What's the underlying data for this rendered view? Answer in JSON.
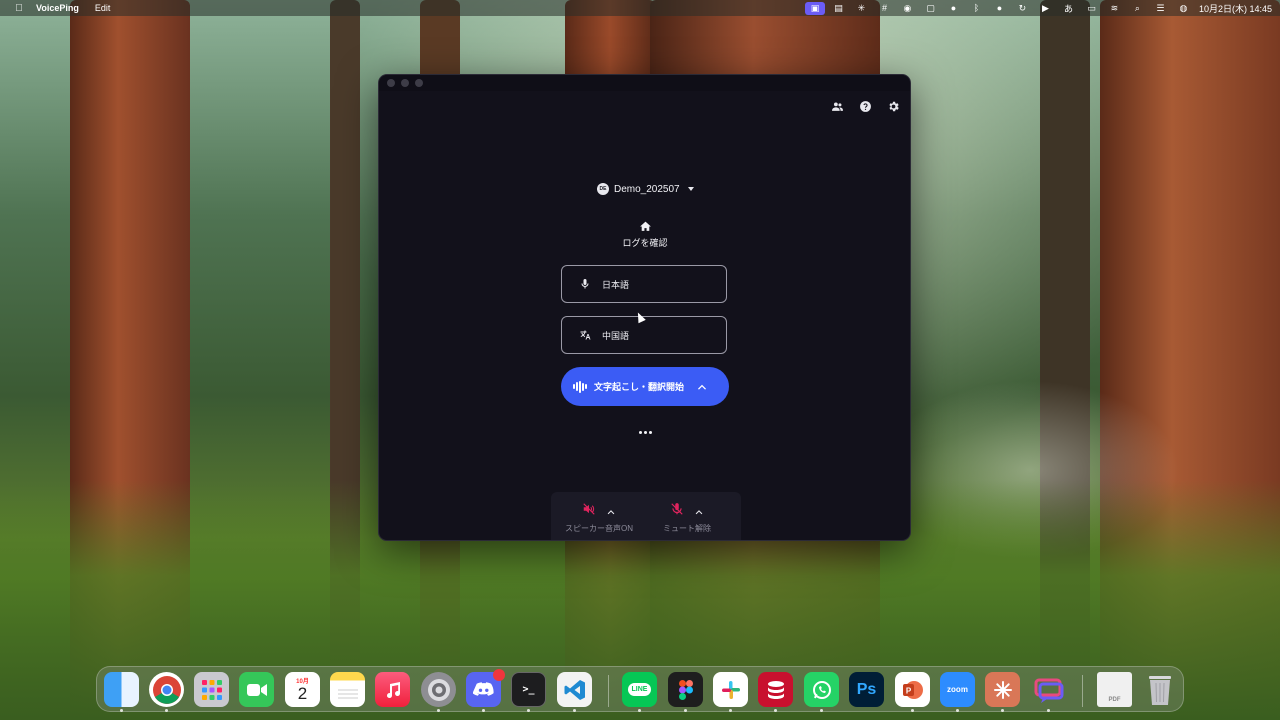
{
  "menubar": {
    "app_name": "VoicePing",
    "menu_edit": "Edit",
    "clock": "10月2日(木) 14:45"
  },
  "app": {
    "workspace_avatar": "DE",
    "workspace_name": "Demo_202507",
    "log_label": "ログを確認",
    "source_language": "日本語",
    "target_language": "中国語",
    "start_label": "文字起こし・翻訳開始",
    "speaker_label": "スピーカー音声ON",
    "mute_label": "ミュート解除",
    "accent_color": "#3b5cf5",
    "muted_icon_color": "#e0245e"
  },
  "dock": {
    "calendar_month": "10月",
    "calendar_day": "2",
    "zoom_label": "zoom",
    "line_label": "LINE",
    "ps_label": "Ps",
    "pdf_label": "PDF"
  }
}
